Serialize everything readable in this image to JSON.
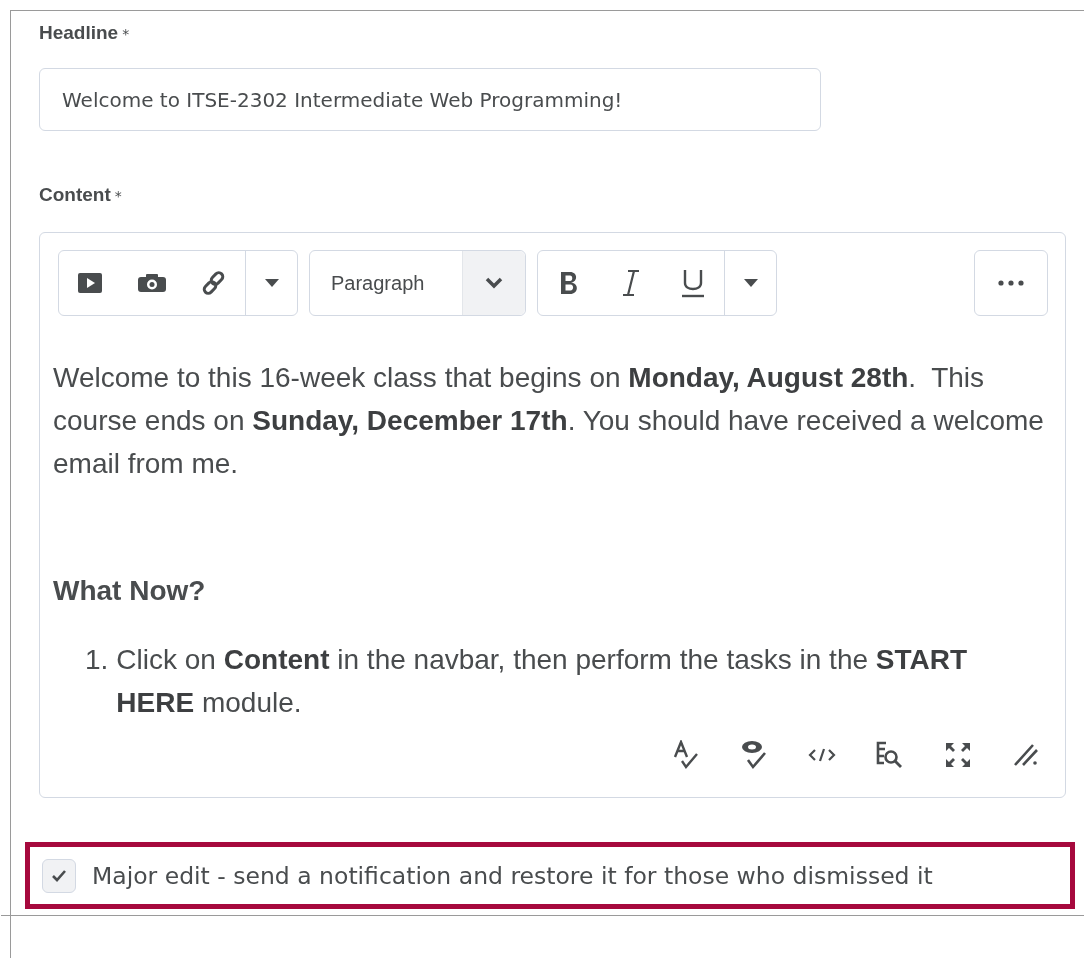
{
  "headline": {
    "label": "Headline",
    "required_mark": "*",
    "value": "Welcome to ITSE-2302 Intermediate Web Programming!"
  },
  "content": {
    "label": "Content",
    "required_mark": "*",
    "toolbar": {
      "block_format": "Paragraph"
    },
    "body": [
      {
        "kind": "paragraph",
        "text": "Welcome to this 16-week class that begins on **Monday, August 28th**.  This course ends on **Sunday, December 17th**. You should have received a welcome email from me."
      },
      {
        "kind": "blank"
      },
      {
        "kind": "heading",
        "text": "What Now?"
      },
      {
        "kind": "ordered_list",
        "items": [
          {
            "number": "1.",
            "text": "Click on **Content** in the navbar, then perform the tasks in the **START HERE** module."
          }
        ]
      }
    ]
  },
  "major_edit": {
    "label": "Major edit - send a notification and restore it for those who dismissed it",
    "checked": true,
    "highlighted": true
  }
}
